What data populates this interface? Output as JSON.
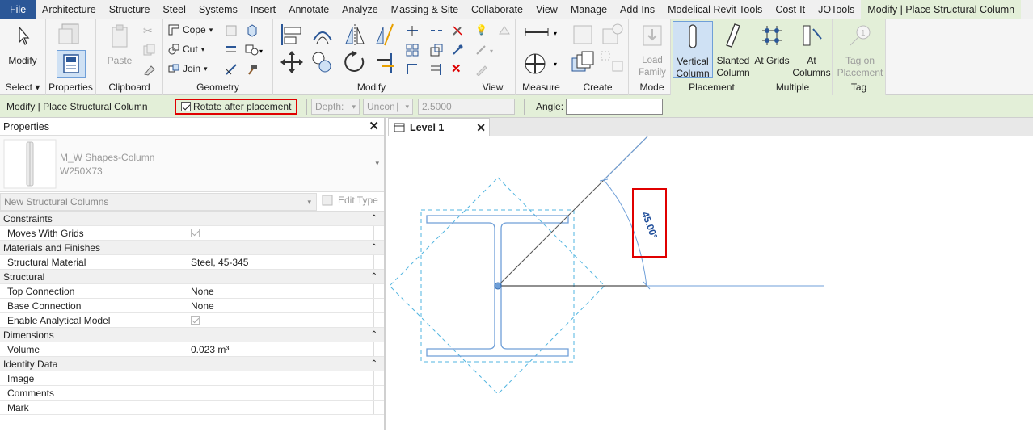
{
  "tabs": [
    "File",
    "Architecture",
    "Structure",
    "Steel",
    "Systems",
    "Insert",
    "Annotate",
    "Analyze",
    "Massing & Site",
    "Collaborate",
    "View",
    "Manage",
    "Add-Ins",
    "Modelical Revit Tools",
    "Cost-It",
    "JOTools",
    "Modify | Place Structural Column"
  ],
  "ribbon": {
    "modify": "Modify",
    "select": "Select ▾",
    "properties": "Properties",
    "clipboard": "Clipboard",
    "paste": "Paste",
    "cope": "Cope",
    "cut": "Cut",
    "join": "Join",
    "geometry": "Geometry",
    "modify_panel": "Modify",
    "view": "View",
    "measure": "Measure",
    "create": "Create",
    "load_family": "Load Family",
    "mode": "Mode",
    "vertical_column": "Vertical Column",
    "slanted_column": "Slanted Column",
    "placement": "Placement",
    "at_grids": "At Grids",
    "at_columns": "At Columns",
    "multiple": "Multiple",
    "tag_on_placement": "Tag on Placement",
    "tag": "Tag"
  },
  "options": {
    "context": "Modify | Place Structural Column",
    "rotate": "Rotate after placement",
    "depth": "Depth:",
    "uncon": "Uncon∣",
    "value": "2.5000",
    "angle": "Angle:",
    "angle_value": ""
  },
  "properties": {
    "title": "Properties",
    "family": "M_W Shapes-Column",
    "type": "W250X73",
    "instance": "New Structural Columns",
    "edit_type": "Edit Type",
    "rows": [
      {
        "cat": "Constraints"
      },
      {
        "k": "Moves With Grids",
        "check": true
      },
      {
        "cat": "Materials and Finishes"
      },
      {
        "k": "Structural Material",
        "v": "Steel, 45-345"
      },
      {
        "cat": "Structural"
      },
      {
        "k": "Top Connection",
        "v": "None"
      },
      {
        "k": "Base Connection",
        "v": "None"
      },
      {
        "k": "Enable Analytical Model",
        "check": true
      },
      {
        "cat": "Dimensions"
      },
      {
        "k": "Volume",
        "v": "0.023 m³"
      },
      {
        "cat": "Identity Data"
      },
      {
        "k": "Image",
        "v": ""
      },
      {
        "k": "Comments",
        "v": ""
      },
      {
        "k": "Mark",
        "v": ""
      }
    ]
  },
  "view": {
    "tab": "Level 1",
    "angle_label": "45.00°"
  },
  "colors": {
    "accent": "#2b5797",
    "context": "#e3efd8",
    "highlight": "#e00000",
    "line": "#6f9fd8"
  }
}
